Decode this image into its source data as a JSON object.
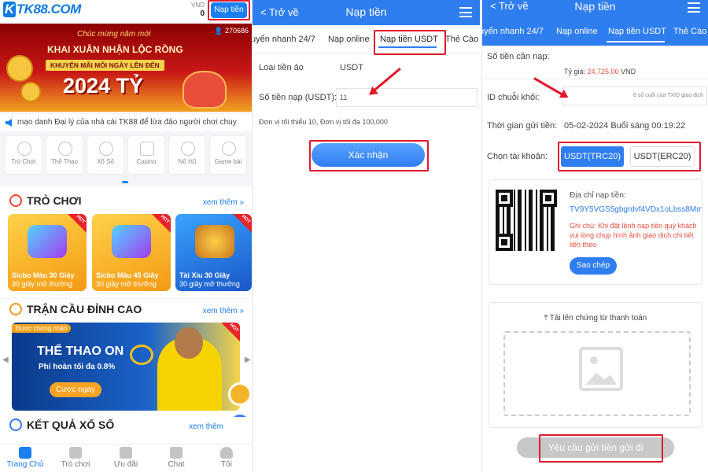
{
  "panel1": {
    "logo": "TK88.COM",
    "balance_currency": "VND",
    "balance_value": "0",
    "topup_button": "Nạp tiền",
    "banner": {
      "greeting": "Chúc mừng năm mới",
      "headline": "KHAI XUÂN NHẬN LỘC RỒNG",
      "promo": "KHUYẾN MÃI MỖI NGÀY LÊN ĐẾN",
      "amount": "2024 TỶ",
      "online_count": "270686"
    },
    "marquee_text": "mạo danh Đại lý của nhà cái TK88 để lừa đảo người chơi chuy",
    "categories": [
      "Trò Chơi",
      "Thể Thao",
      "Xổ Số",
      "Casino",
      "Nổ Hũ",
      "Game bài"
    ],
    "games_section": {
      "title": "TRÒ CHƠI",
      "more": "xem thêm"
    },
    "games": [
      {
        "name": "Sicbo Màu 30 Giây",
        "sub": "30 giây mở thưởng",
        "badge": "HOT"
      },
      {
        "name": "Sicbo Màu 45 Giây",
        "sub": "30 giây mở thưởng",
        "badge": "HOT"
      },
      {
        "name": "Tài Xỉu 30 Giây",
        "sub": "30 giây mở thưởng",
        "badge": "HOT"
      }
    ],
    "match_section": {
      "title": "TRẬN CẦU ĐỈNH CAO",
      "more": "xem thêm"
    },
    "sport_banner": {
      "tag": "Được chứng nhận",
      "title": "THỂ THAO ON",
      "subtitle": "Phí hoàn tối đa 0.8%",
      "button": "Cược ngay",
      "badge": "HOT"
    },
    "lottery_section": {
      "title": "KẾT QUẢ XỔ SỐ",
      "more": "xem thêm"
    },
    "bottom_tabs": [
      "Trang Chủ",
      "Trò chơi",
      "Ưu đãi",
      "Chat",
      "Tôi"
    ]
  },
  "panel2": {
    "back": "Trở về",
    "title": "Nạp tiền",
    "tabs": [
      "uyển nhanh 24/7",
      "Nạp online",
      "Nạp tiền USDT",
      "Thẻ Cào"
    ],
    "currency_label": "Loại tiền ảo",
    "currency_value": "USDT",
    "amount_label": "Số tiền nạp (USDT):",
    "amount_value": "11",
    "limits": "Đơn vị tối thiểu 10, Đơn vị tối đa 100,000",
    "confirm_button": "Xác nhận"
  },
  "panel3": {
    "back": "Trở về",
    "title": "Nạp tiền",
    "tabs": [
      "uyển nhanh 24/7",
      "Nạp online",
      "Nạp tiền USDT",
      "Thẻ Cào"
    ],
    "amount_label": "Số tiền cần nạp:",
    "rate_label": "Tỷ giá:",
    "rate_value": "24,725.00",
    "rate_unit": "VND",
    "chain_label": "ID chuỗi khối:",
    "chain_placeholder": "6 số cuối của TXID giao dịch",
    "time_label": "Thời gian gửi tiền:",
    "time_value": "05-02-2024 Buổi sáng 00:19:22",
    "account_label": "Chọn tài khoản:",
    "account_options": [
      "USDT(TRC20)",
      "USDT(ERC20)"
    ],
    "address_label": "Địa chỉ nạp tiền:",
    "address_value": "TV9Y5VGS5gbgrdvf4VDx1oLbss8Mm",
    "note": "Ghi chú: Khi đặt lệnh nạp tiền quý khách vui lòng chụp hình ảnh giao dịch chi tiết liên theo",
    "copy_button": "Sao chép",
    "upload_label": "Tải lên chứng từ thanh toán",
    "submit_button": "Yêu cầu gửi tiền gửi đi"
  },
  "colors": {
    "brand_blue": "#2f7ef0",
    "highlight_red": "#e0192b",
    "rate_red": "#e84d3d"
  }
}
